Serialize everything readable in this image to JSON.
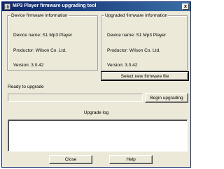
{
  "window": {
    "title": "MP3 Player firmware upgrading tool",
    "close_glyph": "x"
  },
  "device_info": {
    "heading": "Device firmware information",
    "device_name": "Device name: S1 Mp3 Player",
    "productor": "Productor: Wilson Co. Ltd.",
    "version": "Version: 3.0.42"
  },
  "upgraded_info": {
    "heading": "Upgraded firmware information",
    "device_name": "Device name: S1 Mp3 Player",
    "productor": "Productor: Wilson Co. Ltd.",
    "version": "Version: 3.0.42"
  },
  "buttons": {
    "select_file": "Select new firmware file",
    "begin_upgrading": "Begin upgrading",
    "close": "Close",
    "help": "Help"
  },
  "status": "Ready to upgrade",
  "progress": 0,
  "upgrade_log": {
    "label": "Upgrade log",
    "content": ""
  }
}
